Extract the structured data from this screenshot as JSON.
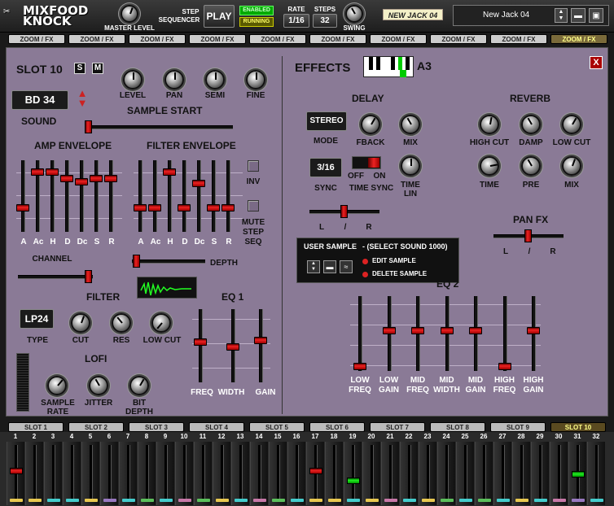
{
  "app": {
    "logo_line1": "MIXFOOD",
    "logo_line2": "KNOCK"
  },
  "topbar": {
    "master_level_label": "MASTER LEVEL",
    "step_label": "STEP",
    "sequencer_label": "SEQUENCER",
    "play_label": "PLAY",
    "enabled_label": "ENABLED",
    "running_label": "RUNNING",
    "rate_label": "RATE",
    "rate_value": "1/16",
    "steps_label": "STEPS",
    "steps_value": "32",
    "swing_label": "SWING",
    "preset_tag": "NEW JACK 04",
    "preset_name": "New Jack 04"
  },
  "zoom_tabs": [
    {
      "label": "ZOOM / FX",
      "color": "#3aa0d8"
    },
    {
      "label": "ZOOM / FX",
      "color": "#7a94b0"
    },
    {
      "label": "ZOOM / FX",
      "color": "#c07070"
    },
    {
      "label": "ZOOM / FX",
      "color": "#c878a8"
    },
    {
      "label": "ZOOM / FX",
      "color": "#a0a0c0"
    },
    {
      "label": "ZOOM / FX",
      "color": "#9aa878"
    },
    {
      "label": "ZOOM / FX",
      "color": "#78a0a0"
    },
    {
      "label": "ZOOM / FX",
      "color": "#80a0b8"
    },
    {
      "label": "ZOOM / FX",
      "color": "#9878c0"
    },
    {
      "label": "ZOOM / FX",
      "color": "#e8d070"
    }
  ],
  "slot": {
    "title": "SLOT 10",
    "solo": "S",
    "mute": "M",
    "level": "LEVEL",
    "pan": "PAN",
    "semi": "SEMI",
    "fine": "FINE",
    "sound_value": "BD 34",
    "sound_label": "SOUND",
    "sample_start": "SAMPLE START",
    "amp_envelope": "AMP ENVELOPE",
    "filter_envelope": "FILTER ENVELOPE",
    "env_labels": [
      "A",
      "Ac",
      "H",
      "D",
      "Dc",
      "S",
      "R"
    ],
    "inv": "INV",
    "mute_step_seq_1": "MUTE",
    "mute_step_seq_2": "STEP",
    "mute_step_seq_3": "SEQ",
    "channel": "CHANNEL",
    "depth": "DEPTH",
    "filter": "FILTER",
    "filter_type": "LP24",
    "type_label": "TYPE",
    "cut": "CUT",
    "res": "RES",
    "low_cut": "LOW CUT",
    "lofi": "LOFI",
    "sample_rate_1": "SAMPLE",
    "sample_rate_2": "RATE",
    "jitter": "JITTER",
    "bit_depth_1": "BIT",
    "bit_depth_2": "DEPTH",
    "eq1": "EQ 1",
    "eq1_labels": [
      "FREQ",
      "WIDTH",
      "GAIN"
    ]
  },
  "effects": {
    "title": "EFFECTS",
    "note": "A3",
    "close": "X",
    "delay": "DELAY",
    "delay_mode_value": "STEREO",
    "mode_label": "MODE",
    "fback": "FBACK",
    "mix": "MIX",
    "sync_value": "3/16",
    "sync_label": "SYNC",
    "off": "OFF",
    "on": "ON",
    "time_sync": "TIME SYNC",
    "time_lin_1": "TIME",
    "time_lin_2": "LIN",
    "pan_l": "L",
    "pan_sep": "/",
    "pan_r": "R",
    "reverb": "REVERB",
    "high_cut": "HIGH CUT",
    "damp": "DAMP",
    "rv_low_cut": "LOW CUT",
    "time": "TIME",
    "pre": "PRE",
    "rv_mix": "MIX",
    "pan_fx": "PAN FX",
    "user_sample_title": "USER SAMPLE",
    "user_sample_hint": "-  (SELECT SOUND 1000)",
    "edit_sample": "EDIT SAMPLE",
    "delete_sample": "DELETE SAMPLE",
    "eq2": "EQ 2",
    "eq2_labels": [
      [
        "LOW",
        "FREQ"
      ],
      [
        "LOW",
        "GAIN"
      ],
      [
        "MID",
        "FREQ"
      ],
      [
        "MID",
        "WIDTH"
      ],
      [
        "MID",
        "GAIN"
      ],
      [
        "HIGH",
        "FREQ"
      ],
      [
        "HIGH",
        "GAIN"
      ]
    ]
  },
  "slots": [
    {
      "label": "SLOT 1",
      "color": "#3aa0d8"
    },
    {
      "label": "SLOT 2",
      "color": "#7a94b0"
    },
    {
      "label": "SLOT 3",
      "color": "#c07070"
    },
    {
      "label": "SLOT 4",
      "color": "#c878a8"
    },
    {
      "label": "SLOT 5",
      "color": "#a0a0c0"
    },
    {
      "label": "SLOT 6",
      "color": "#9aa878"
    },
    {
      "label": "SLOT 7",
      "color": "#78a0a0"
    },
    {
      "label": "SLOT 8",
      "color": "#80a0b8"
    },
    {
      "label": "SLOT 9",
      "color": "#9878c0"
    },
    {
      "label": "SLOT 10",
      "color": "#e8d070"
    }
  ],
  "steps": [
    "1",
    "2",
    "3",
    "4",
    "5",
    "6",
    "7",
    "8",
    "9",
    "10",
    "11",
    "12",
    "13",
    "14",
    "15",
    "16",
    "17",
    "18",
    "19",
    "20",
    "21",
    "22",
    "23",
    "24",
    "25",
    "26",
    "27",
    "28",
    "29",
    "30",
    "31",
    "32"
  ]
}
